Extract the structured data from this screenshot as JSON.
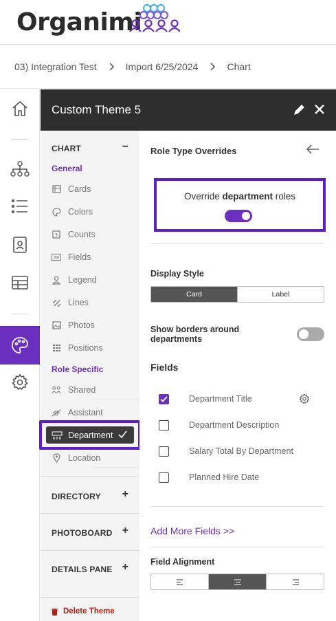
{
  "app": {
    "logo_text": "Organimi",
    "logo_icon": "org-people-icon"
  },
  "breadcrumb": [
    "03) Integration Test",
    "Import 6/25/2024",
    "Chart"
  ],
  "rail": {
    "items": [
      "home-icon",
      "org-chart-icon",
      "list-icon",
      "contact-card-icon",
      "table-icon",
      "palette-icon",
      "gear-icon"
    ],
    "active": "palette-icon"
  },
  "panel": {
    "title": "Custom Theme 5",
    "edit_icon": "pencil-icon",
    "close_icon": "close-icon"
  },
  "nav": {
    "chart": {
      "label": "CHART",
      "toggle": "−"
    },
    "general_label": "General",
    "general_items": [
      "Cards",
      "Colors",
      "Counts",
      "Fields",
      "Legend",
      "Lines",
      "Photos",
      "Positions"
    ],
    "role_label": "Role Specific",
    "role_items": [
      "Shared",
      "Assistant",
      "Department",
      "Location"
    ],
    "active_item": "Department",
    "directory": {
      "label": "DIRECTORY",
      "toggle": "+"
    },
    "photoboard": {
      "label": "PHOTOBOARD",
      "toggle": "+"
    },
    "details": {
      "label": "DETAILS PANE",
      "toggle": "+"
    },
    "delete_label": "Delete Theme"
  },
  "main": {
    "title": "Role Type Overrides",
    "override": {
      "prefix": "Override ",
      "bold": "department",
      "suffix": " roles",
      "enabled": true
    },
    "display_style": {
      "label": "Display Style",
      "options": [
        "Card",
        "Label"
      ],
      "selected": "Card"
    },
    "borders": {
      "label": "Show borders around departments",
      "enabled": false
    },
    "fields": {
      "label": "Fields",
      "items": [
        {
          "label": "Department Title",
          "checked": true
        },
        {
          "label": "Department Description",
          "checked": false
        },
        {
          "label": "Salary Total By Department",
          "checked": false
        },
        {
          "label": "Planned Hire Date",
          "checked": false
        }
      ]
    },
    "add_more": "Add More Fields >>",
    "alignment": {
      "label": "Field Alignment",
      "options": [
        "align-left-icon",
        "align-center-icon",
        "align-right-icon"
      ],
      "selected": "align-center-icon"
    }
  },
  "colors": {
    "accent": "#6a2fbf",
    "highlight": "#5a1fc8",
    "dark_header": "#2e2e2e",
    "danger": "#b42318"
  }
}
